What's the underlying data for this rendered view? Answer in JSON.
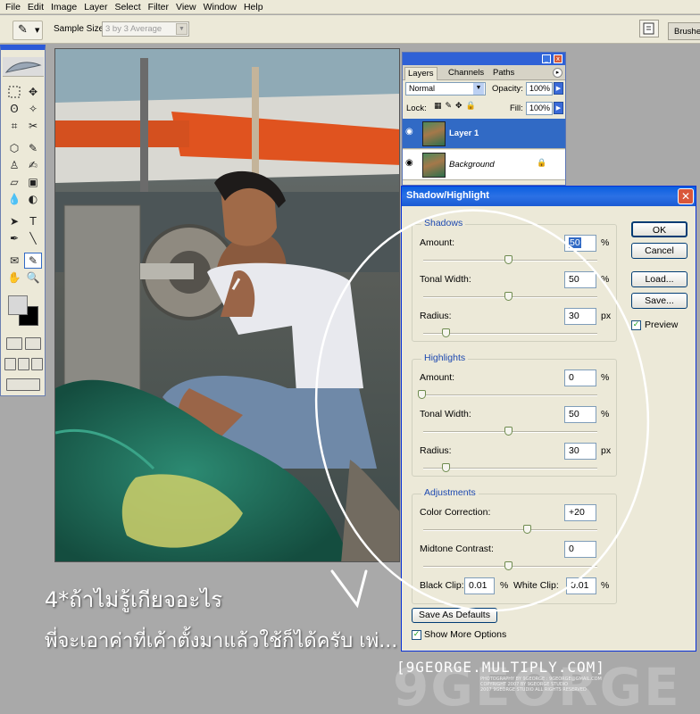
{
  "menu": [
    "File",
    "Edit",
    "Image",
    "Layer",
    "Select",
    "Filter",
    "View",
    "Window",
    "Help"
  ],
  "options_bar": {
    "sample_size_label": "Sample Size:",
    "sample_size_value": "3 by 3 Average",
    "brushes_tab": "Brushe"
  },
  "layers_panel": {
    "tabs": [
      "Layers",
      "Channels",
      "Paths"
    ],
    "blend_mode": "Normal",
    "opacity_label": "Opacity:",
    "opacity_value": "100%",
    "lock_label": "Lock:",
    "fill_label": "Fill:",
    "fill_value": "100%",
    "layers": [
      {
        "name": "Layer 1",
        "selected": true
      },
      {
        "name": "Background",
        "selected": false
      }
    ]
  },
  "dialog": {
    "title": "Shadow/Highlight",
    "shadows": {
      "label": "Shadows",
      "amount_label": "Amount:",
      "amount": "50",
      "amount_unit": "%",
      "tonal_label": "Tonal Width:",
      "tonal": "50",
      "tonal_unit": "%",
      "radius_label": "Radius:",
      "radius": "30",
      "radius_unit": "px"
    },
    "highlights": {
      "label": "Highlights",
      "amount_label": "Amount:",
      "amount": "0",
      "amount_unit": "%",
      "tonal_label": "Tonal Width:",
      "tonal": "50",
      "tonal_unit": "%",
      "radius_label": "Radius:",
      "radius": "30",
      "radius_unit": "px"
    },
    "adjustments": {
      "label": "Adjustments",
      "color_label": "Color Correction:",
      "color": "+20",
      "midtone_label": "Midtone Contrast:",
      "midtone": "0",
      "black_label": "Black Clip:",
      "black": "0.01",
      "black_unit": "%",
      "white_label": "White Clip:",
      "white": "0.01",
      "white_unit": "%"
    },
    "buttons": {
      "ok": "OK",
      "cancel": "Cancel",
      "load": "Load...",
      "save": "Save..."
    },
    "preview_label": "Preview",
    "save_defaults": "Save As Defaults",
    "show_more": "Show More Options"
  },
  "caption": {
    "line1": "4*ถ้าไม่รู้เกียจอะไร",
    "line2": "พี่จะเอาค่าที่เค้าตั้งมาแล้วใช้ก็ได้ครับ เพ่..."
  },
  "watermark": {
    "site": "[9GEORGE.MULTIPLY.COM]",
    "big": "9GEORGE",
    "credit": "PHOTOGRAPHY BY 9GEORGE : 9GEORGE@GMAIL.COM",
    "small1": "COPYRIGHT 2007 BY 9GEORGE STUDIO",
    "small2": "2007 9GEORGE STUDIO ALL RIGHTS RESERVED"
  },
  "colors": {
    "xp_blue": "#0a5fe0",
    "panel_bg": "#ece9d8",
    "group_label": "#1c48b0"
  }
}
